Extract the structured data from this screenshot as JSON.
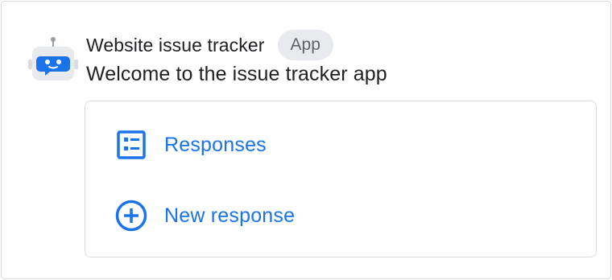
{
  "app": {
    "title": "Website issue tracker",
    "badge": "App",
    "welcome": "Welcome to the issue tracker app"
  },
  "actions": [
    {
      "label": "Responses",
      "icon": "list-icon"
    },
    {
      "label": "New response",
      "icon": "add-circle-icon"
    }
  ],
  "colors": {
    "accent": "#1a73e8",
    "text": "#202124",
    "badge_bg": "#e8eaed",
    "badge_text": "#5f6368",
    "border": "#dadce0",
    "bot_face": "#e8eaed",
    "bot_accent": "#1a73e8"
  }
}
